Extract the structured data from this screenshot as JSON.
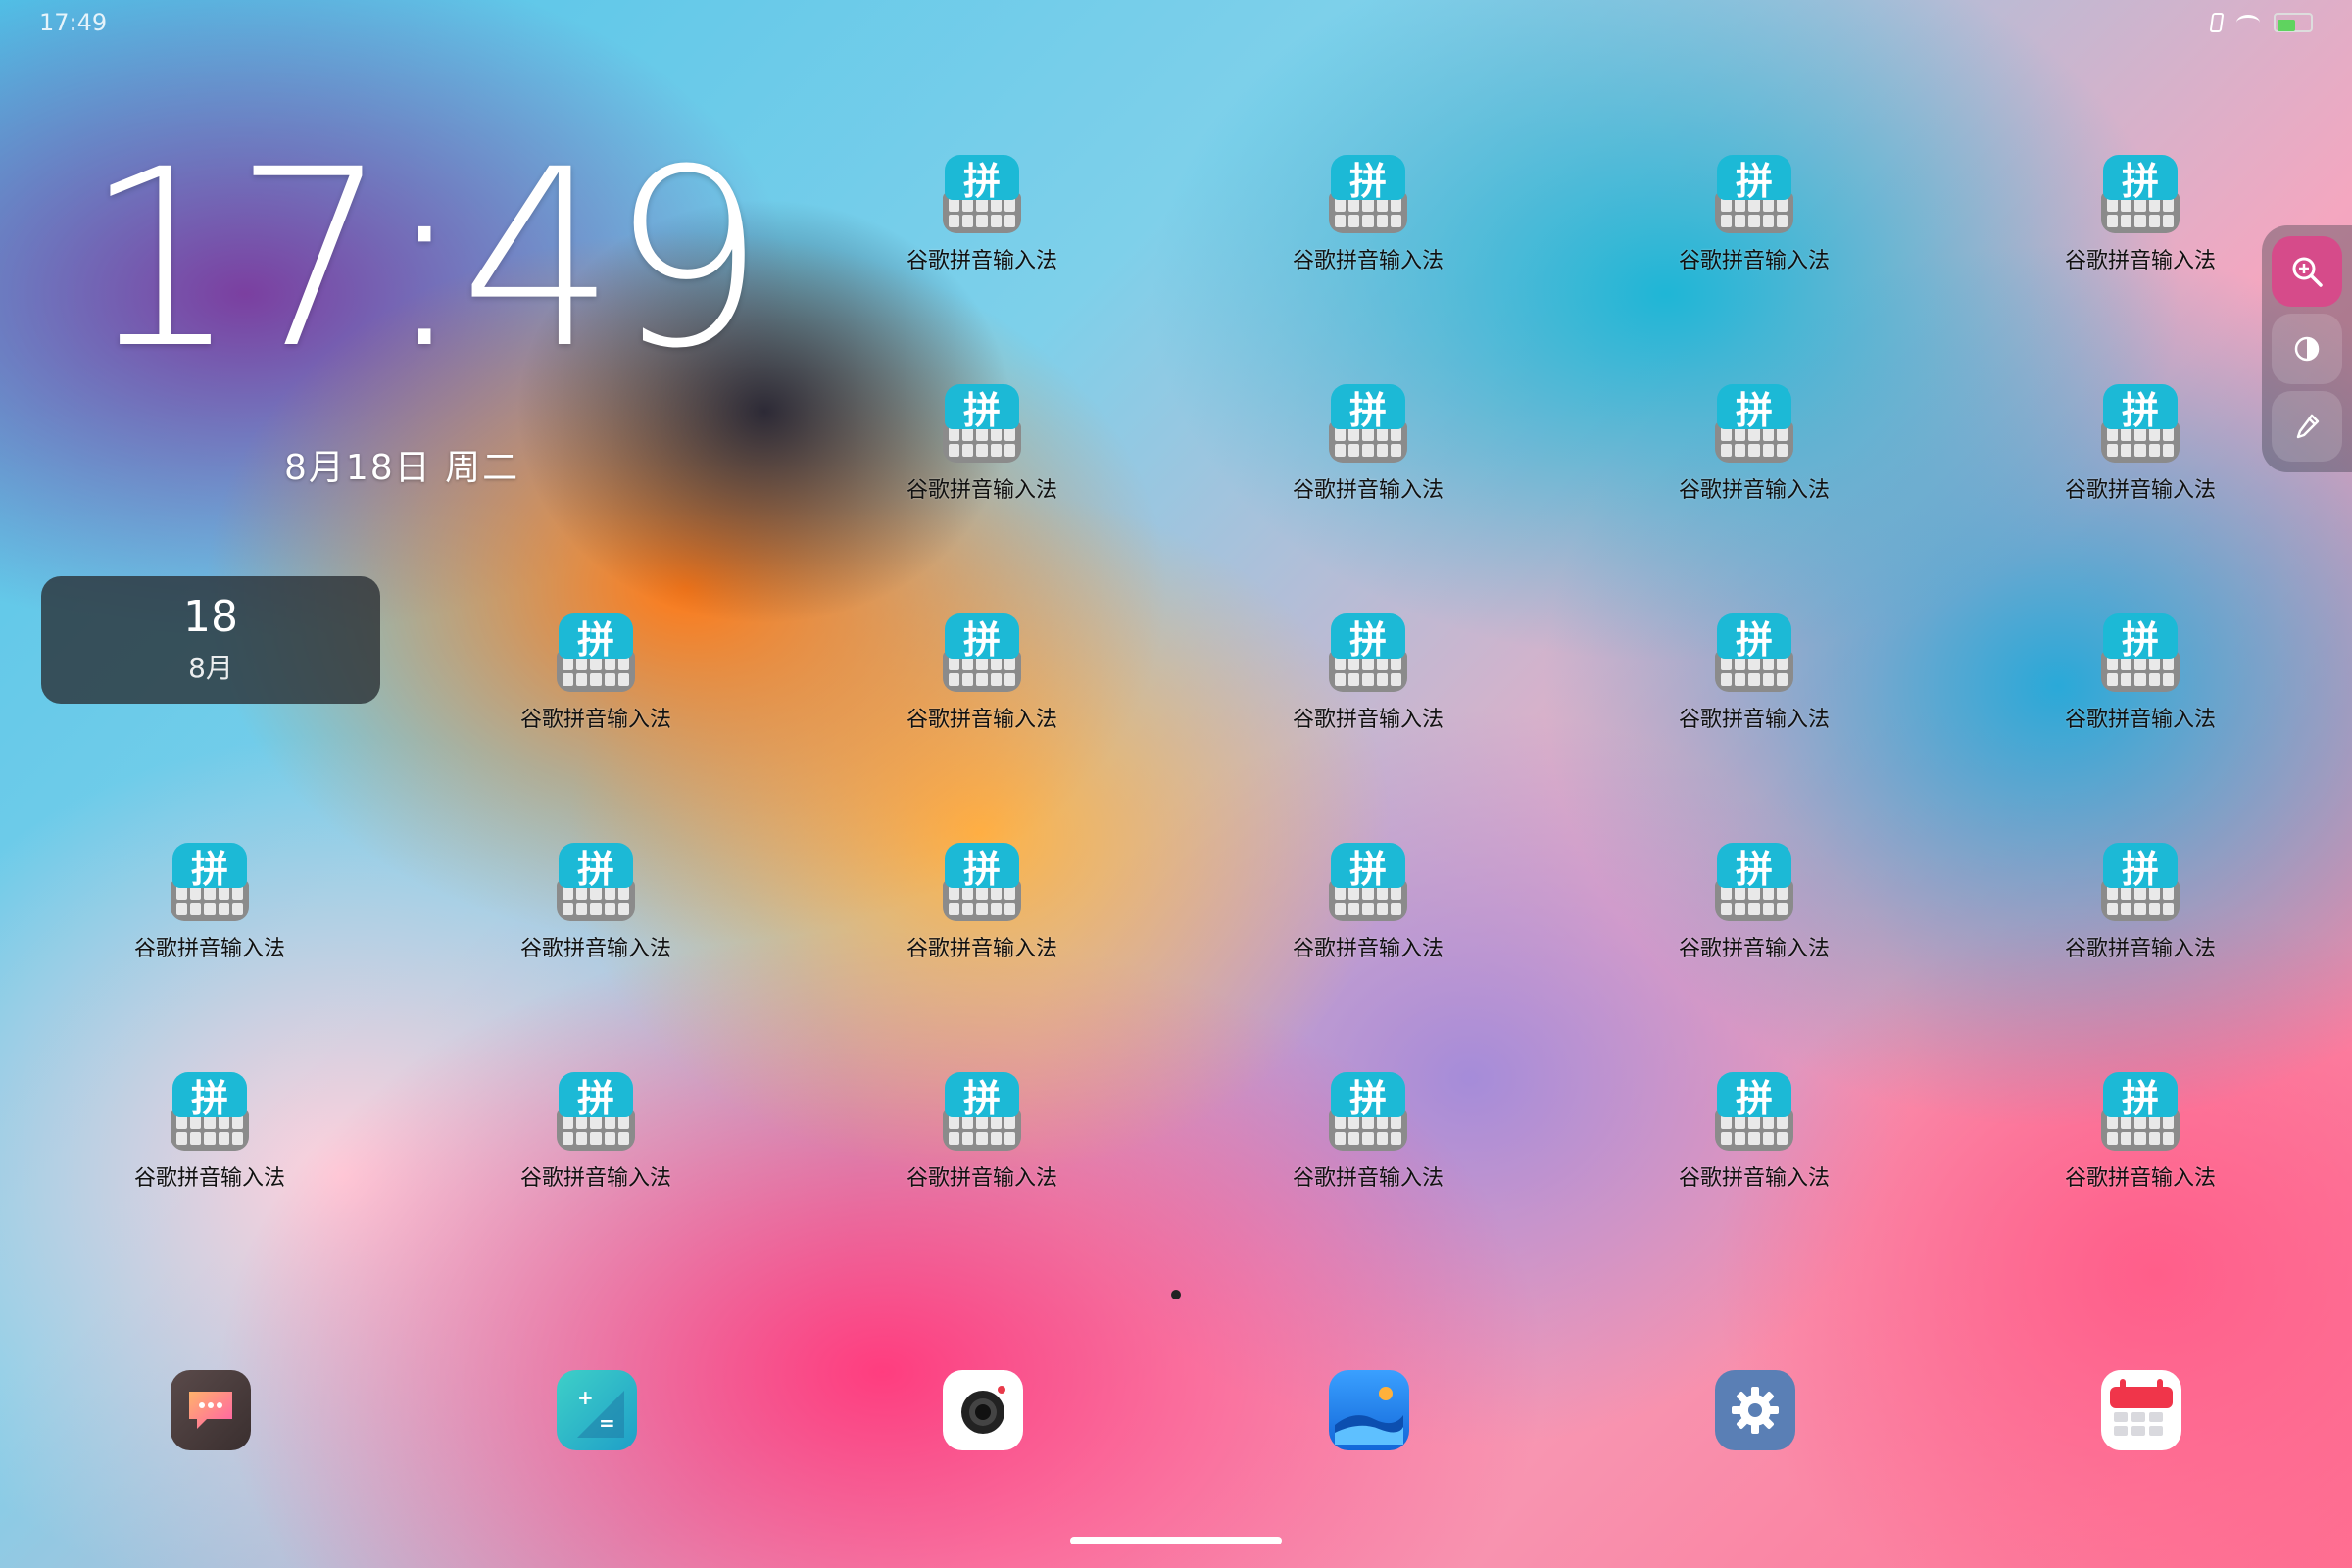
{
  "status_bar": {
    "time": "17:49",
    "battery_level": 0.55
  },
  "lockscreen": {
    "clock": "17:49",
    "date": "8月18日 周二"
  },
  "calendar_widget": {
    "day": "18",
    "month": "8月"
  },
  "app_grid": {
    "label": "谷歌拼音输入法",
    "icon_glyph": "拼",
    "accent_color": "#1cb9d6"
  },
  "side_tools": [
    {
      "name": "zoom",
      "glyph": "⊕"
    },
    {
      "name": "contrast",
      "glyph": "◑"
    },
    {
      "name": "picker",
      "glyph": "✎"
    }
  ],
  "dock": [
    {
      "name": "messages",
      "color": "#4a3a3a"
    },
    {
      "name": "calculator",
      "color": "#2bb8c8"
    },
    {
      "name": "camera",
      "color": "#ffffff"
    },
    {
      "name": "gallery",
      "color": "#1f7ee8"
    },
    {
      "name": "settings",
      "color": "#4d79b8"
    },
    {
      "name": "calendar",
      "color": "#ffffff"
    }
  ]
}
